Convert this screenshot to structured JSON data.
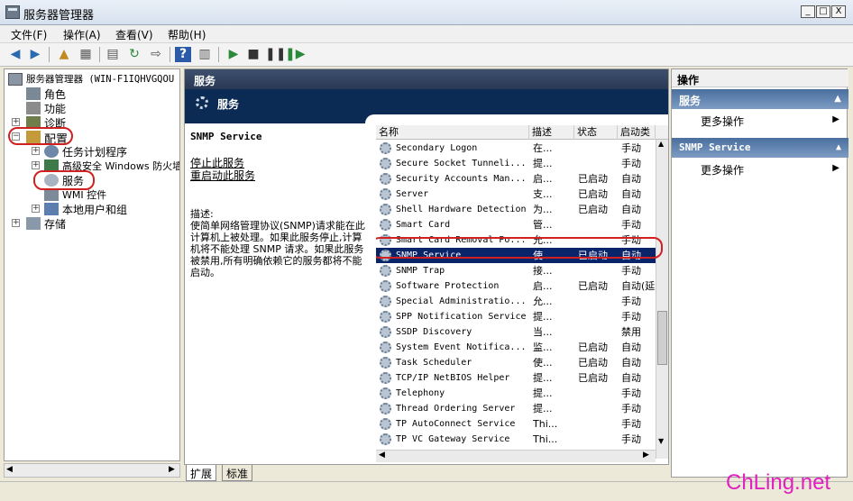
{
  "window": {
    "title": "服务器管理器",
    "min": "_",
    "max": "□",
    "close": "X"
  },
  "menu": [
    "文件(F)",
    "操作(A)",
    "查看(V)",
    "帮助(H)"
  ],
  "tree": {
    "root": "服务器管理器 (WIN-F1IQHVGQOU",
    "items": [
      {
        "label": "角色",
        "level": 1
      },
      {
        "label": "功能",
        "level": 1
      },
      {
        "label": "诊断",
        "level": 1
      },
      {
        "label": "配置",
        "level": 1
      },
      {
        "label": "任务计划程序",
        "level": 2
      },
      {
        "label": "高级安全 Windows 防火墙",
        "level": 2
      },
      {
        "label": "服务",
        "level": 2
      },
      {
        "label": "WMI 控件",
        "level": 2
      },
      {
        "label": "本地用户和组",
        "level": 2
      },
      {
        "label": "存储",
        "level": 1
      }
    ]
  },
  "middle": {
    "header": "服务",
    "banner": "服务",
    "selected_service": "SNMP Service",
    "links": [
      "停止此服务",
      "重启动此服务"
    ],
    "desc_label": "描述:",
    "desc_text": "使简单网络管理协议(SNMP)请求能在此计算机上被处理。如果此服务停止,计算机将不能处理 SNMP 请求。如果此服务被禁用,所有明确依赖它的服务都将不能启动。",
    "columns": [
      "名称",
      "描述",
      "状态",
      "启动类"
    ],
    "rows": [
      {
        "name": "Secondary Logon",
        "desc": "在...",
        "status": "",
        "start": "手动"
      },
      {
        "name": "Secure Socket Tunneli...",
        "desc": "提...",
        "status": "",
        "start": "手动"
      },
      {
        "name": "Security Accounts Man...",
        "desc": "启...",
        "status": "已启动",
        "start": "自动"
      },
      {
        "name": "Server",
        "desc": "支...",
        "status": "已启动",
        "start": "自动"
      },
      {
        "name": "Shell Hardware Detection",
        "desc": "为...",
        "status": "已启动",
        "start": "自动"
      },
      {
        "name": "Smart Card",
        "desc": "管...",
        "status": "",
        "start": "手动"
      },
      {
        "name": "Smart Card Removal Po...",
        "desc": "允...",
        "status": "",
        "start": "手动"
      },
      {
        "name": "SNMP Service",
        "desc": "使...",
        "status": "已启动",
        "start": "自动",
        "selected": true
      },
      {
        "name": "SNMP Trap",
        "desc": "接...",
        "status": "",
        "start": "手动"
      },
      {
        "name": "Software Protection",
        "desc": "启...",
        "status": "已启动",
        "start": "自动(延"
      },
      {
        "name": "Special Administratio...",
        "desc": "允...",
        "status": "",
        "start": "手动"
      },
      {
        "name": "SPP Notification Service",
        "desc": "提...",
        "status": "",
        "start": "手动"
      },
      {
        "name": "SSDP Discovery",
        "desc": "当...",
        "status": "",
        "start": "禁用"
      },
      {
        "name": "System Event Notifica...",
        "desc": "监...",
        "status": "已启动",
        "start": "自动"
      },
      {
        "name": "Task Scheduler",
        "desc": "使...",
        "status": "已启动",
        "start": "自动"
      },
      {
        "name": "TCP/IP NetBIOS Helper",
        "desc": "提...",
        "status": "已启动",
        "start": "自动"
      },
      {
        "name": "Telephony",
        "desc": "提...",
        "status": "",
        "start": "手动"
      },
      {
        "name": "Thread Ordering Server",
        "desc": "提...",
        "status": "",
        "start": "手动"
      },
      {
        "name": "TP AutoConnect Service",
        "desc": "Thi...",
        "status": "",
        "start": "手动"
      },
      {
        "name": "TP VC Gateway Service",
        "desc": "Thi...",
        "status": "",
        "start": "手动"
      }
    ],
    "tabs": [
      "扩展",
      "标准"
    ]
  },
  "actions": {
    "header": "操作",
    "sections": [
      {
        "title": "服务",
        "item": "更多操作"
      },
      {
        "title": "SNMP Service",
        "item": "更多操作"
      }
    ]
  },
  "watermark": "ChLing.net"
}
